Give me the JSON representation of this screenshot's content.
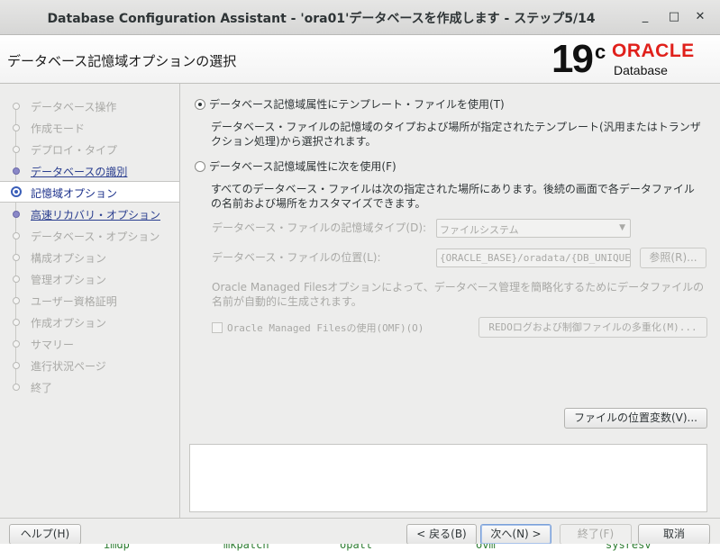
{
  "window": {
    "title": "Database Configuration Assistant - 'ora01'データベースを作成します - ステップ5/14",
    "minimize_glyph": "_",
    "maximize_glyph": "□",
    "close_glyph": "✕"
  },
  "header": {
    "page_title": "データベース記憶域オプションの選択",
    "version_number": "19",
    "version_suffix": "c",
    "brand": "ORACLE",
    "product": "Database"
  },
  "nav": {
    "items": [
      {
        "label": "データベース操作",
        "state": "disabled"
      },
      {
        "label": "作成モード",
        "state": "disabled"
      },
      {
        "label": "デプロイ・タイプ",
        "state": "disabled"
      },
      {
        "label": "データベースの識別",
        "state": "link"
      },
      {
        "label": "記憶域オプション",
        "state": "active"
      },
      {
        "label": "高速リカバリ・オプション",
        "state": "link"
      },
      {
        "label": "データベース・オプション",
        "state": "disabled"
      },
      {
        "label": "構成オプション",
        "state": "disabled"
      },
      {
        "label": "管理オプション",
        "state": "disabled"
      },
      {
        "label": "ユーザー資格証明",
        "state": "disabled"
      },
      {
        "label": "作成オプション",
        "state": "disabled"
      },
      {
        "label": "サマリー",
        "state": "disabled"
      },
      {
        "label": "進行状況ページ",
        "state": "disabled"
      },
      {
        "label": "終了",
        "state": "disabled"
      }
    ]
  },
  "content": {
    "option_template": {
      "label": "データベース記憶域属性にテンプレート・ファイルを使用(T)",
      "desc_line1": "データベース・ファイルの記憶域のタイプおよび場所が指定されたテンプレート(汎用またはトランザ",
      "desc_line2": "クション処理)から選択されます。",
      "selected": true
    },
    "option_custom": {
      "label": "データベース記憶域属性に次を使用(F)",
      "desc_line1": "すべてのデータベース・ファイルは次の指定された場所にあります。後続の画面で各データファイル",
      "desc_line2": "の名前および場所をカスタマイズできます。",
      "selected": false
    },
    "storage_type_label": "データベース・ファイルの記憶域タイプ(D):",
    "storage_type_value": "ファイルシステム",
    "location_label": "データベース・ファイルの位置(L):",
    "location_value": "{ORACLE_BASE}/oradata/{DB_UNIQUE_NAME}",
    "browse_button": "参照(R)...",
    "omf_desc_line1": "Oracle Managed Filesオプションによって、データベース管理を簡略化するためにデータファイルの",
    "omf_desc_line2": "名前が自動的に生成されます。",
    "omf_checkbox_label": "Oracle Managed Filesの使用(OMF)(O)",
    "multiplex_button": "REDOログおよび制御ファイルの多重化(M)...",
    "file_vars_button": "ファイルの位置変数(V)..."
  },
  "footer": {
    "help": "ヘルプ(H)",
    "back": "< 戻る(B)",
    "next": "次へ(N) >",
    "finish": "終了(F)",
    "cancel": "取消"
  },
  "terminal": {
    "items": [
      "imdp",
      "mkpatch",
      "opatt",
      "ovm",
      "sysresv"
    ]
  }
}
